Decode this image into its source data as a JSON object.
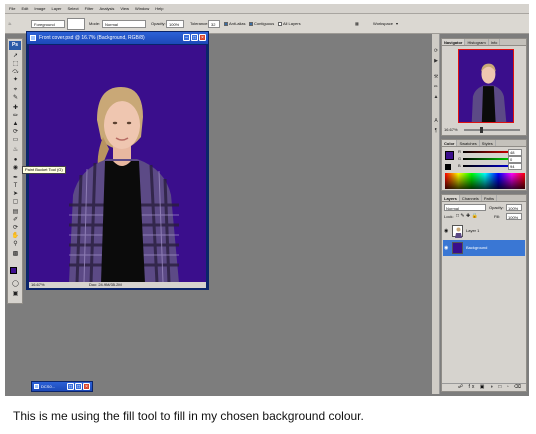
{
  "menu": [
    "File",
    "Edit",
    "Image",
    "Layer",
    "Select",
    "Filter",
    "Analysis",
    "View",
    "Window",
    "Help"
  ],
  "options": {
    "fill_source": "Foreground",
    "mode_label": "Mode:",
    "mode_value": "Normal",
    "opacity_label": "Opacity:",
    "opacity_value": "100%",
    "tolerance_label": "Tolerance:",
    "tolerance_value": "32",
    "antialias_label": "Anti-alias",
    "contiguous_label": "Contiguous",
    "alllayers_label": "All Layers",
    "workspace_label": "Workspace"
  },
  "toolbox": {
    "logo": "Ps",
    "tooltip": "Paint Bucket Tool (G)"
  },
  "document": {
    "title": "Front cover.psd @ 16.7% (Background, RGB/8)",
    "zoom": "16.67%",
    "doc_size": "Doc: 24.9M/35.2M"
  },
  "navigator": {
    "tabs": [
      "Navigator",
      "Histogram",
      "Info"
    ],
    "zoom": "16.67%"
  },
  "color_panel": {
    "tabs": [
      "Color",
      "Swatches",
      "Styles"
    ],
    "r_label": "R",
    "r_value": "48",
    "g_label": "G",
    "g_value": "0",
    "b_label": "B",
    "b_value": "94"
  },
  "layers_panel": {
    "tabs": [
      "Layers",
      "Channels",
      "Paths"
    ],
    "blend": "Normal",
    "opacity_label": "Opacity:",
    "opacity_value": "100%",
    "lock_label": "Lock:",
    "fill_label": "Fill:",
    "fill_value": "100%",
    "layers": [
      {
        "name": "Layer 1"
      },
      {
        "name": "Background"
      }
    ]
  },
  "minimized_doc": {
    "title": "DCS0..."
  },
  "caption": "This is me using the fill tool to fill in my chosen background colour.",
  "colors": {
    "background_fill": "#3a0e8c",
    "accent": "#2c61d6",
    "selected_layer": "#3a77d4"
  }
}
